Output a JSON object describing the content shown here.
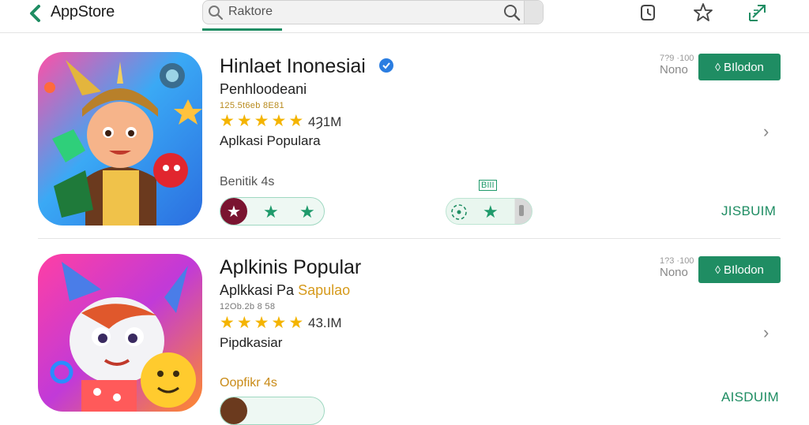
{
  "header": {
    "brand": "AppStore",
    "search_text": "Raktore",
    "icons": [
      "back-chevron-icon",
      "search-icon",
      "clock-icon",
      "star-icon",
      "share-icon"
    ]
  },
  "apps": [
    {
      "title": "Hinlaet Inonesiai",
      "developer": "Penhloodeani",
      "tiny_meta": "125.5t6eb 8E81",
      "stars": 5,
      "downloads": "4Ȝ1M",
      "category": "Aplkasi Populara",
      "section_label": "Benitik 4s",
      "price_small": "7?9 ·100",
      "price": "Nono",
      "install_label": "BIlodon",
      "tag": "BIII",
      "action": "JISBUIM"
    },
    {
      "title": "Aplkinis Popular",
      "developer": "Aplkkasi Pa",
      "developer_highlight": "Sapulao",
      "tiny_meta": "12Ob.2b 8 58",
      "stars": 5,
      "downloads": "43.IM",
      "category": "Pipdkasiar",
      "section_label": "Oopfikr 4s",
      "price_small": "1?3 ·100",
      "price": "Nono",
      "install_label": "BIlodon",
      "action": "AISDUIM"
    }
  ],
  "colors": {
    "accent": "#1f8d63",
    "star": "#f4b400",
    "verified": "#2a7de1",
    "maroon": "#7a1430"
  }
}
